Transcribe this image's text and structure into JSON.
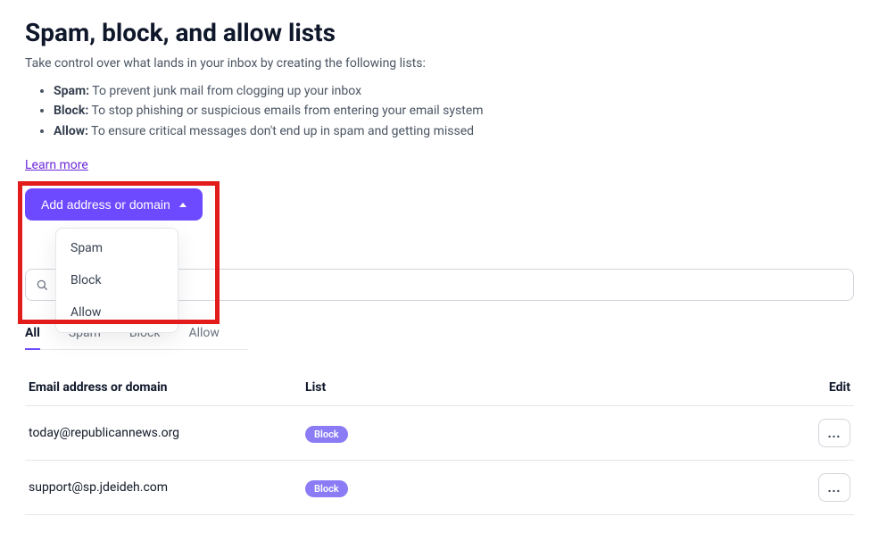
{
  "header": {
    "title": "Spam, block, and allow lists",
    "subtitle": "Take control over what lands in your inbox by creating the following lists:",
    "bullets": [
      {
        "label": "Spam:",
        "text": " To prevent junk mail from clogging up your inbox"
      },
      {
        "label": "Block:",
        "text": " To stop phishing or suspicious emails from entering your email system"
      },
      {
        "label": "Allow:",
        "text": " To ensure critical messages don't end up in spam and getting missed"
      }
    ],
    "learn_more": "Learn more"
  },
  "add_button": {
    "label": "Add address or domain"
  },
  "dropdown": {
    "items": [
      "Spam",
      "Block",
      "Allow"
    ]
  },
  "search": {
    "placeholder": "Search"
  },
  "tabs": [
    "All",
    "Spam",
    "Block",
    "Allow"
  ],
  "table": {
    "columns": {
      "address": "Email address or domain",
      "list": "List",
      "edit": "Edit"
    },
    "rows": [
      {
        "address": "today@republicannews.org",
        "list": "Block"
      },
      {
        "address": "support@sp.jdeideh.com",
        "list": "Block"
      }
    ],
    "edit_label": "..."
  }
}
